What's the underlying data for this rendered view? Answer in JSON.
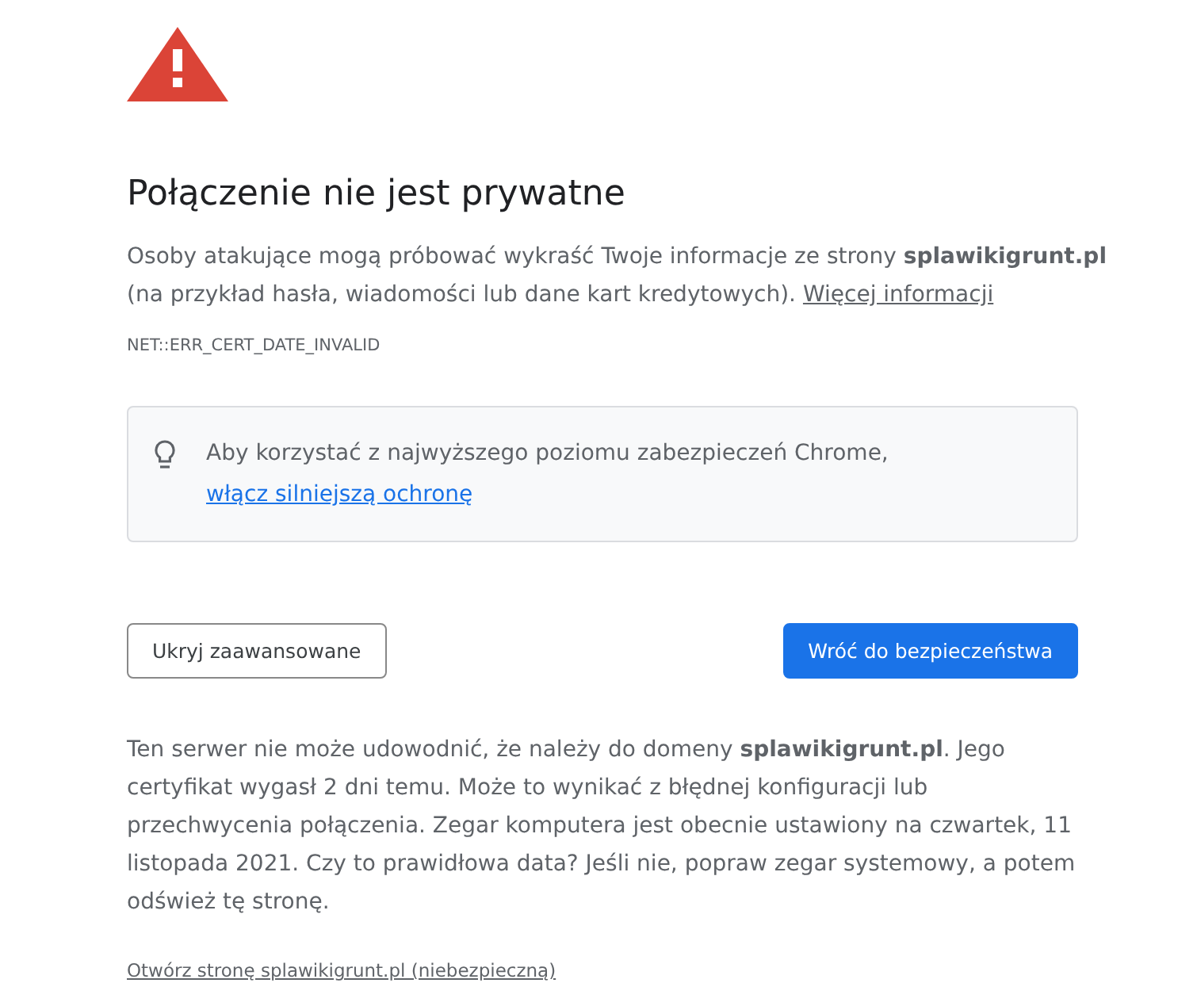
{
  "heading": "Połączenie nie jest prywatne",
  "intro": {
    "text": "Osoby atakujące mogą próbować wykraść Twoje informacje ze strony **splawikigrunt.pl** (na przykład hasła, wiadomości lub dane kart kredytowych).",
    "link": "Więcej informacji"
  },
  "error_code": "NET::ERR_CERT_DATE_INVALID",
  "tip": {
    "text": "Aby korzystać z najwyższego poziomu zabezpieczeń Chrome,",
    "link": "włącz silniejszą ochronę"
  },
  "buttons": [
    {
      "label": "Ukryj zaawansowane",
      "kind": "secondary"
    },
    {
      "label": "Wróć do bezpieczeństwa",
      "kind": "primary"
    }
  ],
  "details": "Ten serwer nie może udowodnić, że należy do domeny **splawikigrunt.pl**. Jego certyfikat wygasł 2 dni temu. Może to wynikać z błędnej konfiguracji lub przechwycenia połączenia. Zegar komputera jest obecnie ustawiony na czwartek, 11 listopada 2021. Czy to prawidłowa data? Jeśli nie, popraw zegar systemowy, a potem odśwież tę stronę.",
  "proceed_link": "Otwórz stronę splawikigrunt.pl (niebezpieczną)"
}
